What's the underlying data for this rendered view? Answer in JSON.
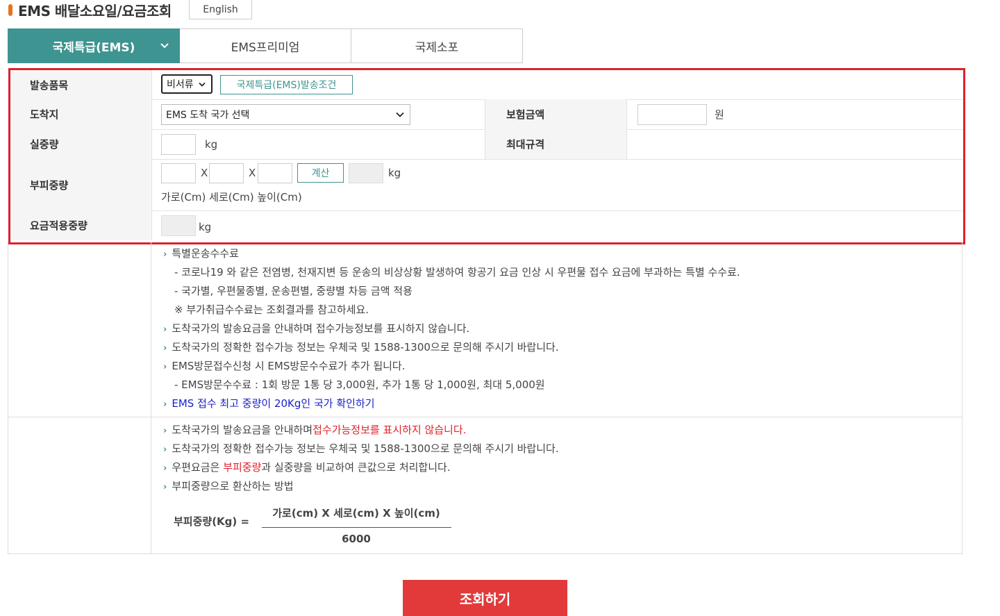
{
  "header": {
    "title": "EMS 배달소요일/요금조회",
    "lang_button": "English"
  },
  "tabs": [
    {
      "label": "국제특급(EMS)",
      "active": true
    },
    {
      "label": "EMS프리미엄",
      "active": false
    },
    {
      "label": "국제소포",
      "active": false
    }
  ],
  "form": {
    "item": {
      "label": "발송품목",
      "select_value": "비서류",
      "cond_button": "국제특급(EMS)발송조건"
    },
    "dest": {
      "label": "도착지",
      "select_value": "EMS 도착 국가 선택",
      "insurance_label": "보험금액",
      "insurance_unit": "원"
    },
    "weight": {
      "label": "실중량",
      "unit": "kg",
      "max_label": "최대규격"
    },
    "volume": {
      "label": "부피중량",
      "times": "X",
      "calc_button": "계산",
      "unit": "kg",
      "hint": "가로(Cm) 세로(Cm) 높이(Cm)"
    },
    "applied": {
      "label": "요금적용중량",
      "unit": "kg"
    }
  },
  "info1": {
    "l1": "특별운송수수료",
    "l2": "- 코로나19 와 같은 전염병, 천재지변 등 운송의 비상상황 발생하여 항공기 요금 인상 시 우편물 접수 요금에 부과하는 특별 수수료.",
    "l3": "- 국가별, 우편물종별, 운송편별, 중량별 차등 금액 적용",
    "l4": "※ 부가취급수수료는 조회결과를 참고하세요.",
    "l5": "도착국가의 발송요금을 안내하며 접수가능정보를 표시하지 않습니다.",
    "l6": "도착국가의 정확한 접수가능 정보는 우체국 및 1588-1300으로 문의해 주시기 바랍니다.",
    "l7": "EMS방문접수신청 시 EMS방문수수료가 추가 됩니다.",
    "l8": "- EMS방문수수료 : 1회 방문 1통 당 3,000원, 추가 1통 당 1,000원, 최대 5,000원",
    "l9": "EMS 접수 최고 중량이 20Kg인 국가 확인하기"
  },
  "info2": {
    "l1a": "도착국가의 발송요금을 안내하며",
    "l1b": "접수가능정보를 표시하지 않습니다.",
    "l2": "도착국가의 정확한 접수가능 정보는 우체국 및 1588-1300으로 문의해 주시기 바랍니다.",
    "l3a": "우편요금은 ",
    "l3b": "부피중량",
    "l3c": "과 실중량을 비교하여 큰값으로 처리합니다.",
    "l4": "부피중량으로 환산하는 방법",
    "formula_label": "부피중량(Kg) =",
    "formula_num": "가로(cm) X 세로(cm) X 높이(cm)",
    "formula_den": "6000"
  },
  "submit_label": "조회하기",
  "colors": {
    "accent": "#3e9491",
    "highlight": "#e0202a",
    "submit": "#e23a3b",
    "link": "#1a22c9",
    "title_mark": "#e8731d"
  }
}
